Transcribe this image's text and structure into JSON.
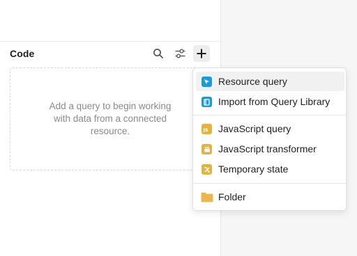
{
  "panel": {
    "title": "Code",
    "empty_message": "Add a query to begin working with data from a connected resource.",
    "toolbar": [
      {
        "icon": "search-icon"
      },
      {
        "icon": "sliders-icon"
      },
      {
        "icon": "plus-icon"
      }
    ]
  },
  "menu": {
    "items": [
      {
        "label": "Resource query",
        "icon": "resource-query-icon",
        "color": "#1e9ad6"
      },
      {
        "label": "Import from Query Library",
        "icon": "query-library-icon",
        "color": "#1e9ad6"
      },
      {
        "label": "JavaScript query",
        "icon": "javascript-icon",
        "color": "#e3b341"
      },
      {
        "label": "JavaScript transformer",
        "icon": "transformer-icon",
        "color": "#e3b341"
      },
      {
        "label": "Temporary state",
        "icon": "variable-icon",
        "color": "#e3b341"
      },
      {
        "label": "Folder",
        "icon": "folder-icon",
        "color": "#ecb64d"
      }
    ],
    "hovered_item": "Resource query"
  },
  "colors": {
    "blue_icon": "#1e9ad6",
    "yellow_icon": "#e3b341",
    "folder": "#ecb64d"
  }
}
